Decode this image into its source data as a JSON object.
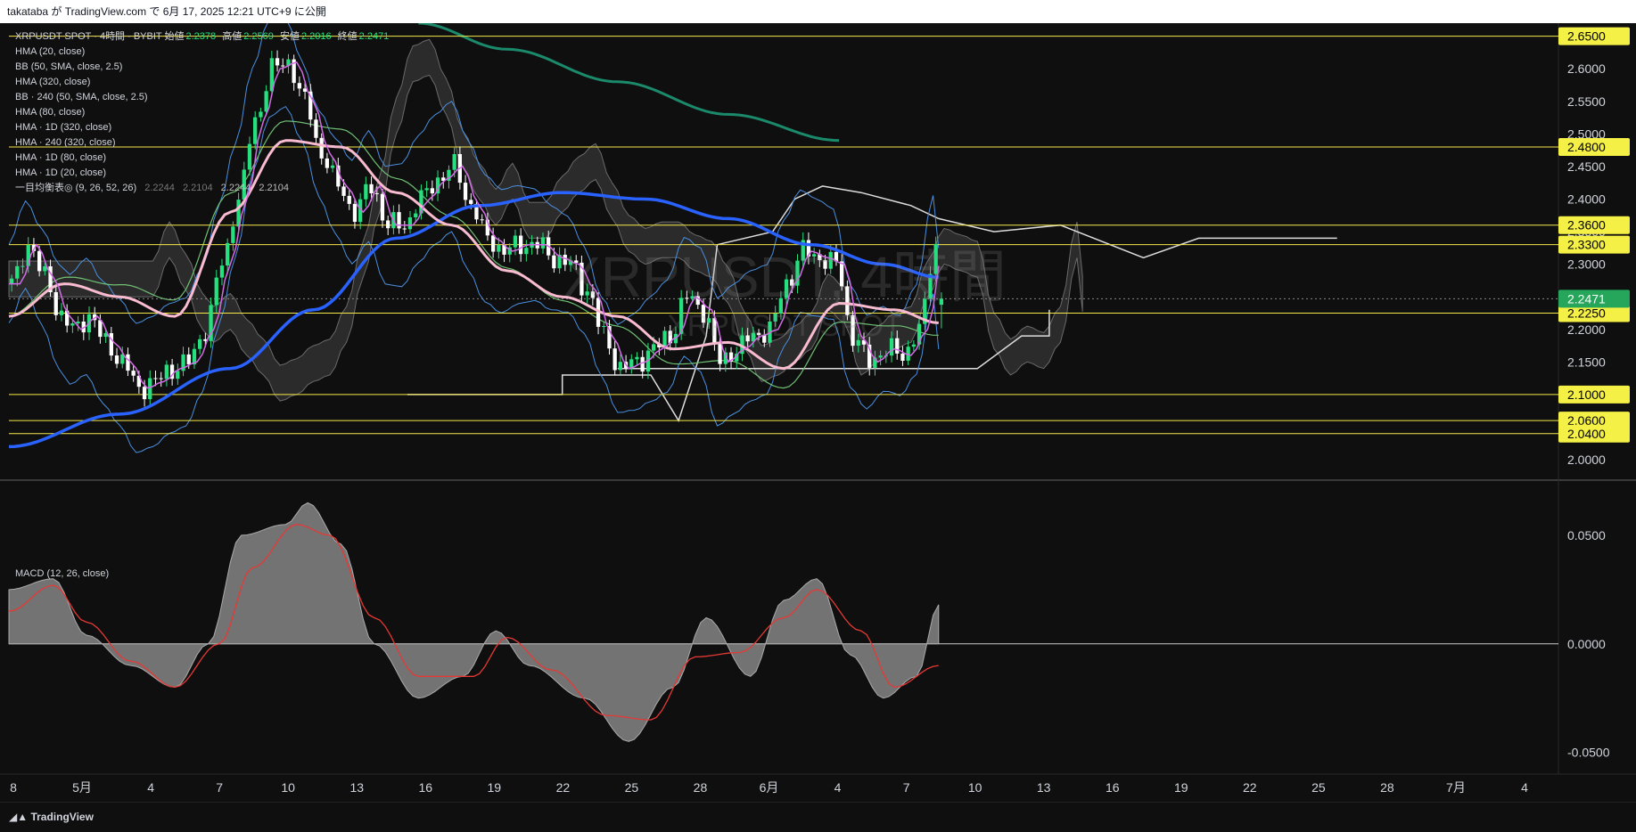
{
  "header": {
    "text": "takataba が TradingView.com で 6月 17, 2025 12:21 UTC+9 に公開"
  },
  "legend": {
    "symbol": "XRPUSDT SPOT · 4時間 · BYBIT",
    "open_label": "始値",
    "open": "2.2378",
    "high_label": "高値",
    "high": "2.2569",
    "low_label": "安値",
    "low": "2.2016",
    "close_label": "終値",
    "close": "2.2471",
    "indicators": [
      "HMA (20, close)",
      "BB (50, SMA, close, 2.5)",
      "HMA (320, close)",
      "BB · 240 (50, SMA, close, 2.5)",
      "HMA (80, close)",
      "HMA · 1D (320, close)",
      "HMA · 240 (320, close)",
      "HMA · 1D (80, close)",
      "HMA · 1D (20, close)"
    ],
    "ichimoku": {
      "name": "一目均衡表◎ (9, 26, 52, 26)",
      "v1": "2.2244",
      "v2": "2.2104",
      "v3": "2.2244",
      "v4": "2.2104"
    }
  },
  "watermark": {
    "main": "XRPUSDT, 4時間",
    "sub": "XRPUSDT SPOT"
  },
  "macd_label": "MACD (12, 26, close)",
  "footer": {
    "brand": "TradingView"
  },
  "colors": {
    "bg": "#0f0f0f",
    "up": "#26e07f",
    "down": "#ffffff",
    "level_line": "#f5e94a",
    "level_tag_bg": "#f5f046",
    "current_tag_bg": "#26a65b",
    "hma320": "#2962ff",
    "hma80": "#f8bbd0",
    "hma20": "#d46ae6",
    "bb": "#4a8fe0",
    "teal": "#1b8a6b",
    "macd_signal": "#e53935"
  },
  "chart_data": [
    {
      "type": "candlestick",
      "title": "XRPUSDT SPOT · 4時間 · BYBIT",
      "ylim": [
        1.97,
        2.67
      ],
      "price_ticks": [
        "2.6500",
        "2.6000",
        "2.5500",
        "2.5000",
        "2.4500",
        "2.4000",
        "2.3500",
        "2.3000",
        "2.2500",
        "2.2000",
        "2.1500",
        "2.1000",
        "2.0500",
        "2.0000"
      ],
      "x_ticks": [
        "8",
        "5月",
        "4",
        "7",
        "10",
        "13",
        "16",
        "19",
        "22",
        "25",
        "28",
        "6月",
        "4",
        "7",
        "10",
        "13",
        "16",
        "19",
        "22",
        "25",
        "28",
        "7月",
        "4"
      ],
      "levels": [
        "2.6500",
        "2.4800",
        "2.3600",
        "2.3300",
        "2.2250",
        "2.1000",
        "2.0600",
        "2.0400"
      ],
      "current_price": "2.2471",
      "ohlc_last": {
        "open": 2.2378,
        "high": 2.2569,
        "low": 2.2016,
        "close": 2.2471
      },
      "price_path": [
        [
          0,
          2.27
        ],
        [
          3,
          2.33
        ],
        [
          6,
          2.28
        ],
        [
          9,
          2.22
        ],
        [
          11,
          2.2
        ],
        [
          14,
          2.22
        ],
        [
          17,
          2.18
        ],
        [
          20,
          2.15
        ],
        [
          23,
          2.11
        ],
        [
          26,
          2.12
        ],
        [
          29,
          2.14
        ],
        [
          32,
          2.15
        ],
        [
          35,
          2.2
        ],
        [
          38,
          2.3
        ],
        [
          41,
          2.4
        ],
        [
          44,
          2.52
        ],
        [
          47,
          2.6
        ],
        [
          50,
          2.61
        ],
        [
          53,
          2.55
        ],
        [
          56,
          2.47
        ],
        [
          59,
          2.42
        ],
        [
          62,
          2.38
        ],
        [
          65,
          2.42
        ],
        [
          68,
          2.36
        ],
        [
          71,
          2.36
        ],
        [
          74,
          2.4
        ],
        [
          77,
          2.43
        ],
        [
          80,
          2.45
        ],
        [
          83,
          2.39
        ],
        [
          86,
          2.34
        ],
        [
          89,
          2.32
        ],
        [
          92,
          2.33
        ],
        [
          95,
          2.33
        ],
        [
          98,
          2.31
        ],
        [
          101,
          2.3
        ],
        [
          104,
          2.26
        ],
        [
          107,
          2.19
        ],
        [
          110,
          2.14
        ],
        [
          113,
          2.15
        ],
        [
          116,
          2.17
        ],
        [
          119,
          2.19
        ],
        [
          122,
          2.25
        ],
        [
          125,
          2.23
        ],
        [
          128,
          2.15
        ],
        [
          131,
          2.17
        ],
        [
          134,
          2.19
        ],
        [
          137,
          2.2
        ],
        [
          140,
          2.27
        ],
        [
          143,
          2.32
        ],
        [
          146,
          2.31
        ],
        [
          149,
          2.3
        ],
        [
          152,
          2.19
        ],
        [
          155,
          2.15
        ],
        [
          158,
          2.17
        ],
        [
          161,
          2.16
        ],
        [
          164,
          2.2
        ],
        [
          167,
          2.33
        ],
        [
          168,
          2.2471
        ]
      ],
      "hma320": [
        [
          0,
          2.02
        ],
        [
          20,
          2.07
        ],
        [
          40,
          2.14
        ],
        [
          55,
          2.23
        ],
        [
          70,
          2.34
        ],
        [
          85,
          2.39
        ],
        [
          100,
          2.41
        ],
        [
          115,
          2.4
        ],
        [
          130,
          2.37
        ],
        [
          145,
          2.33
        ],
        [
          158,
          2.3
        ],
        [
          168,
          2.28
        ]
      ],
      "hma80": [
        [
          0,
          2.22
        ],
        [
          10,
          2.27
        ],
        [
          20,
          2.25
        ],
        [
          30,
          2.22
        ],
        [
          40,
          2.38
        ],
        [
          50,
          2.49
        ],
        [
          60,
          2.48
        ],
        [
          70,
          2.41
        ],
        [
          80,
          2.36
        ],
        [
          90,
          2.29
        ],
        [
          100,
          2.25
        ],
        [
          110,
          2.22
        ],
        [
          120,
          2.17
        ],
        [
          130,
          2.18
        ],
        [
          140,
          2.14
        ],
        [
          150,
          2.24
        ],
        [
          160,
          2.23
        ],
        [
          168,
          2.21
        ]
      ],
      "teal_line": [
        [
          74,
          2.67
        ],
        [
          90,
          2.63
        ],
        [
          110,
          2.58
        ],
        [
          130,
          2.53
        ],
        [
          150,
          2.49
        ]
      ]
    },
    {
      "type": "area",
      "title": "MACD (12, 26, close)",
      "ylim": [
        -0.06,
        0.075
      ],
      "ticks": [
        "0.0500",
        "0.0000",
        "-0.0500"
      ],
      "macd": [
        [
          0,
          0.025
        ],
        [
          8,
          0.03
        ],
        [
          14,
          0.004
        ],
        [
          22,
          -0.01
        ],
        [
          30,
          -0.02
        ],
        [
          36,
          0.0
        ],
        [
          42,
          0.05
        ],
        [
          50,
          0.055
        ],
        [
          54,
          0.065
        ],
        [
          60,
          0.046
        ],
        [
          66,
          0.0
        ],
        [
          74,
          -0.025
        ],
        [
          82,
          -0.015
        ],
        [
          88,
          0.006
        ],
        [
          94,
          -0.01
        ],
        [
          104,
          -0.025
        ],
        [
          112,
          -0.045
        ],
        [
          120,
          -0.02
        ],
        [
          126,
          0.012
        ],
        [
          134,
          -0.015
        ],
        [
          140,
          0.02
        ],
        [
          146,
          0.03
        ],
        [
          152,
          -0.005
        ],
        [
          158,
          -0.025
        ],
        [
          164,
          -0.015
        ],
        [
          168,
          0.018
        ]
      ],
      "signal": [
        [
          0,
          0.015
        ],
        [
          8,
          0.027
        ],
        [
          14,
          0.01
        ],
        [
          22,
          -0.008
        ],
        [
          30,
          -0.02
        ],
        [
          38,
          0.0
        ],
        [
          44,
          0.035
        ],
        [
          52,
          0.055
        ],
        [
          58,
          0.05
        ],
        [
          66,
          0.012
        ],
        [
          74,
          -0.015
        ],
        [
          84,
          -0.015
        ],
        [
          90,
          0.003
        ],
        [
          98,
          -0.012
        ],
        [
          108,
          -0.033
        ],
        [
          116,
          -0.035
        ],
        [
          124,
          -0.006
        ],
        [
          132,
          -0.004
        ],
        [
          140,
          0.012
        ],
        [
          146,
          0.025
        ],
        [
          154,
          0.006
        ],
        [
          160,
          -0.02
        ],
        [
          168,
          -0.01
        ]
      ]
    }
  ]
}
